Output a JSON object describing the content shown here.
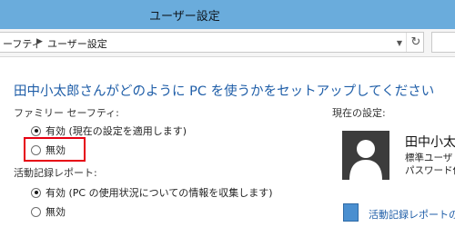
{
  "window": {
    "title": "ユーザー設定"
  },
  "address_bar": {
    "crumbs": [
      "ーフティ",
      "ユーザー設定"
    ],
    "dropdown_icon": "chevron-down-icon",
    "refresh_icon": "refresh-icon",
    "refresh_glyph": "↻",
    "search_icon": "search-icon"
  },
  "main": {
    "heading": "田中小太郎さんがどのように PC を使うかをセットアップしてください",
    "family_safety": {
      "label": "ファミリー セーフティ:",
      "options": [
        {
          "label": "有効 (現在の設定を適用します)",
          "checked": true
        },
        {
          "label": "無効",
          "checked": false
        }
      ]
    },
    "activity_report": {
      "label": "活動記録レポート:",
      "options": [
        {
          "label": "有効 (PC の使用状況についての情報を収集します)",
          "checked": true
        },
        {
          "label": "無効",
          "checked": false
        }
      ]
    }
  },
  "side": {
    "current_settings_label": "現在の設定:",
    "user": {
      "name": "田中小太",
      "account_type": "標準ユーザ",
      "password": "パスワード保"
    },
    "report_link": "活動記録レポートの"
  },
  "colors": {
    "titlebar": "#6aacdc",
    "heading": "#1f5ea8",
    "highlight": "#e60012",
    "avatar": "#3c3c3c"
  }
}
